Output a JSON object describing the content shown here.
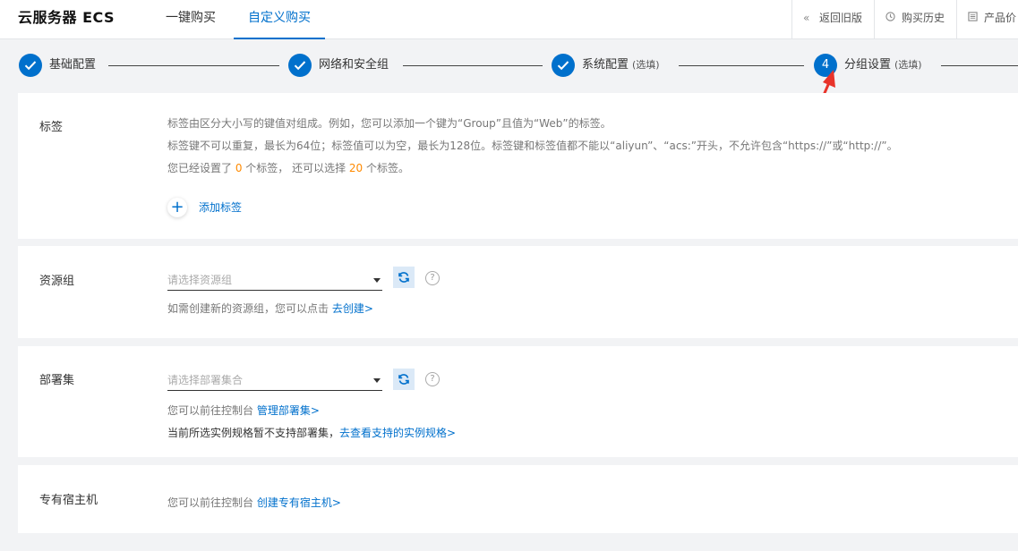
{
  "header": {
    "title": "云服务器 ECS",
    "tabs": [
      {
        "label": "一键购买",
        "active": false
      },
      {
        "label": "自定义购买",
        "active": true
      }
    ],
    "actions": [
      {
        "label": "返回旧版",
        "icon": "double-chevron-left-icon"
      },
      {
        "label": "购买历史",
        "icon": "clock-icon"
      },
      {
        "label": "产品价",
        "icon": "list-icon"
      }
    ]
  },
  "steps": [
    {
      "label": "基础配置",
      "optional": "",
      "status": "done"
    },
    {
      "label": "网络和安全组",
      "optional": "",
      "status": "done"
    },
    {
      "label": "系统配置",
      "optional": "(选填)",
      "status": "done"
    },
    {
      "label": "分组设置",
      "optional": "(选填)",
      "status": "current",
      "number": "4"
    }
  ],
  "tags": {
    "label": "标签",
    "desc1": "标签由区分大小写的键值对组成。例如，您可以添加一个键为“Group”且值为“Web”的标签。",
    "desc2": "标签键不可以重复，最长为64位；标签值可以为空，最长为128位。标签键和标签值都不能以“aliyun”、“acs:”开头，不允许包含“https://”或“http://”。",
    "count_prefix": "您已经设置了 ",
    "count_set": "0",
    "count_mid": " 个标签， 还可以选择 ",
    "count_remain": "20",
    "count_suffix": " 个标签。",
    "add_label": "添加标签"
  },
  "resource_group": {
    "label": "资源组",
    "placeholder": "请选择资源组",
    "hint_text": "如需创建新的资源组，您可以点击 ",
    "hint_link": "去创建>"
  },
  "deployment_set": {
    "label": "部署集",
    "placeholder": "请选择部署集合",
    "hint1_text": "您可以前往控制台 ",
    "hint1_link": "管理部署集>",
    "hint2_text": "当前所选实例规格暂不支持部署集，",
    "hint2_link": "去查看支持的实例规格>"
  },
  "dedicated_host": {
    "label": "专有宿主机",
    "hint_text": "您可以前往控制台 ",
    "hint_link": "创建专有宿主机>"
  },
  "colors": {
    "primary": "#0070cc",
    "highlight": "#ff8a00",
    "annotation_arrow": "#e8332a"
  }
}
